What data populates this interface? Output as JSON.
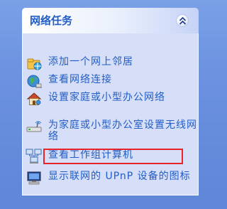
{
  "panel": {
    "title": "网络任务",
    "collapse_icon": "double-chevron-up-icon",
    "items": [
      {
        "label": "添加一个网上邻居",
        "icon": "add-network-place-icon"
      },
      {
        "label": "查看网络连接",
        "icon": "network-connections-icon"
      },
      {
        "label": "设置家庭或小型办公网络",
        "icon": "home-network-setup-icon"
      },
      {
        "label": "为家庭或小型办公室设置无线网络",
        "icon": "wireless-setup-icon"
      },
      {
        "label": "查看工作组计算机",
        "icon": "workgroup-computers-icon"
      },
      {
        "label": "显示联网的 UPnP 设备的图标",
        "icon": "upnp-devices-icon"
      }
    ]
  },
  "colors": {
    "link_text": "#215dc6",
    "panel_body": "#d6dff7",
    "highlight_border": "#e8232c"
  }
}
